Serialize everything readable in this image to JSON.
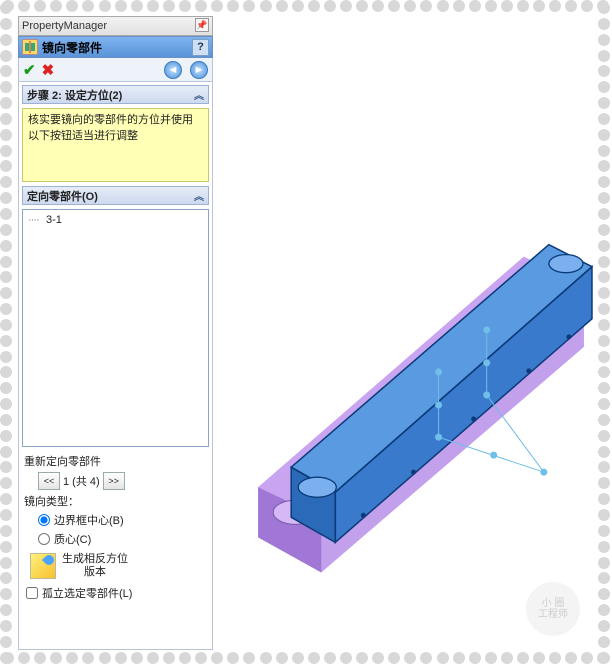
{
  "header": {
    "title": "PropertyManager"
  },
  "feature": {
    "title": "镜向零部件"
  },
  "step": {
    "header": "步骤 2: 设定方位(2)",
    "message": "核实要镜向的零部件的方位并使用以下按钮适当进行调整"
  },
  "orient": {
    "header": "定向零部件(O)",
    "items": [
      "3-1"
    ]
  },
  "reorient": {
    "label": "重新定向零部件",
    "pager_prev": "<<",
    "pager_text": "1 (共 4)",
    "pager_next": ">>"
  },
  "mirrorType": {
    "label": "镜向类型：",
    "opt1": "边界框中心(B)",
    "opt2": "质心(C)"
  },
  "generate": {
    "line1": "生成相反方位",
    "line2": "版本"
  },
  "isolate": {
    "label": "孤立选定零部件(L)"
  },
  "watermark": {
    "l1": "小 圈",
    "l2": "工程师"
  }
}
